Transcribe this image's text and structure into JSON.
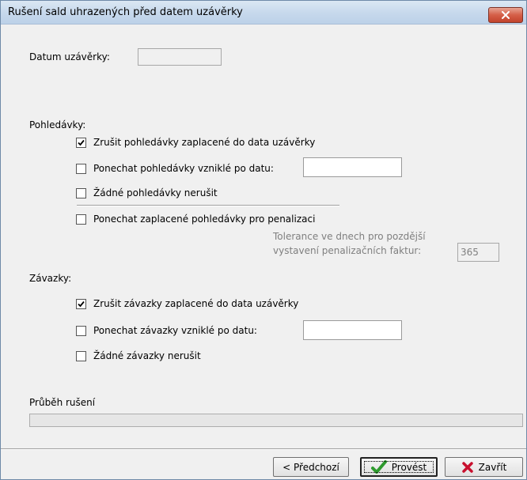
{
  "window": {
    "title": "Rušení sald uhrazených před datem uzávěrky"
  },
  "closing_date": {
    "label": "Datum uzávěrky:",
    "value": ""
  },
  "receivables": {
    "section_label": "Pohledávky:",
    "options": [
      {
        "label": "Zrušit pohledávky zaplacené do data uzávěrky",
        "checked": true
      },
      {
        "label": "Ponechat pohledávky vzniklé po datu:",
        "checked": false,
        "date_value": ""
      },
      {
        "label": "Žádné pohledávky nerušit",
        "checked": false
      },
      {
        "label": "Ponechat zaplacené pohledávky pro penalizaci",
        "checked": false
      }
    ],
    "tolerance_label_line1": "Tolerance ve dnech pro pozdější",
    "tolerance_label_line2": "vystavení penalizačních faktur:",
    "tolerance_value": "365"
  },
  "liabilities": {
    "section_label": "Závazky:",
    "options": [
      {
        "label": "Zrušit závazky zaplacené do data uzávěrky",
        "checked": true
      },
      {
        "label": "Ponechat závazky vzniklé po datu:",
        "checked": false,
        "date_value": ""
      },
      {
        "label": "Žádné závazky nerušit",
        "checked": false
      }
    ]
  },
  "progress": {
    "label": "Průběh rušení",
    "value": 0
  },
  "buttons": {
    "previous": "< Předchozí",
    "execute": "Provést",
    "close": "Zavřít"
  },
  "colors": {
    "check_green": "#2e9a2e",
    "close_red": "#c8102e",
    "close_button": "#d55f48"
  },
  "icons": {
    "execute": "green-checkmark-icon",
    "close": "red-x-icon"
  }
}
